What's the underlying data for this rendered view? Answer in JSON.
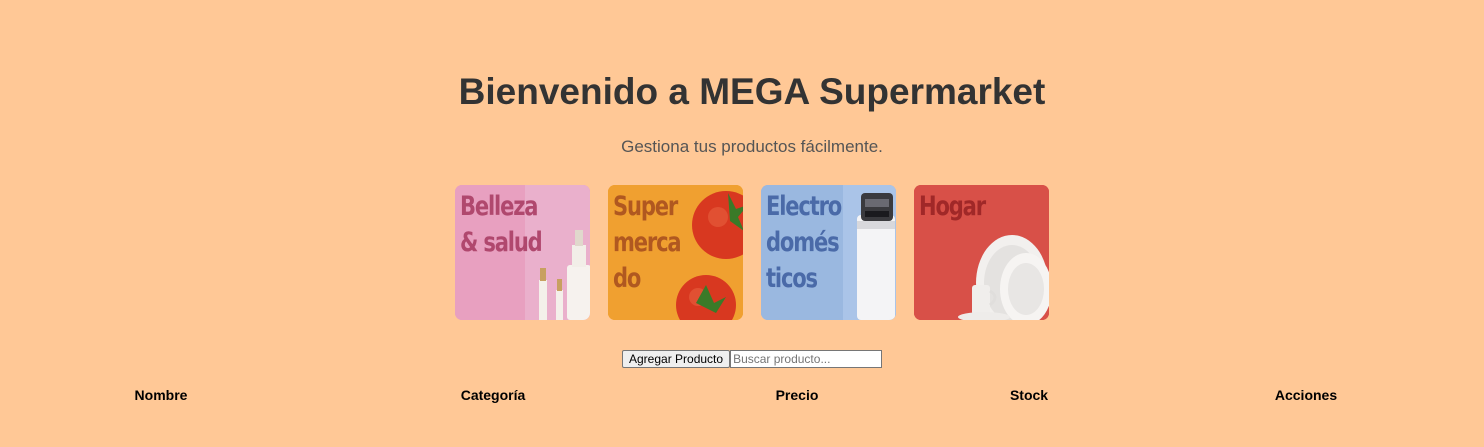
{
  "header": {
    "title": "Bienvenido a MEGA Supermarket",
    "subtitle": "Gestiona tus productos fácilmente."
  },
  "categories": [
    {
      "label": "Belleza\n& salud",
      "bg": "#e8a0c0",
      "text_color": "#b0486e",
      "art": "cosmetics-bottles-icon"
    },
    {
      "label": "Super\nmerca\ndo",
      "bg": "#f0a030",
      "text_color": "#b05820",
      "art": "tomato-icon"
    },
    {
      "label": "Electro\ndomés\nticos",
      "bg": "#9ab8e0",
      "text_color": "#4a6aa8",
      "art": "appliance-icon"
    },
    {
      "label": "Hogar",
      "bg": "#d85048",
      "text_color": "#a02828",
      "art": "dishes-icon"
    }
  ],
  "toolbar": {
    "add_label": "Agregar Producto",
    "search_placeholder": "Buscar producto..."
  },
  "table": {
    "columns": [
      "Nombre",
      "Categoría",
      "Precio",
      "Stock",
      "Acciones"
    ],
    "rows": []
  },
  "colors": {
    "page_bg": "#ffc896",
    "title": "#333333"
  }
}
